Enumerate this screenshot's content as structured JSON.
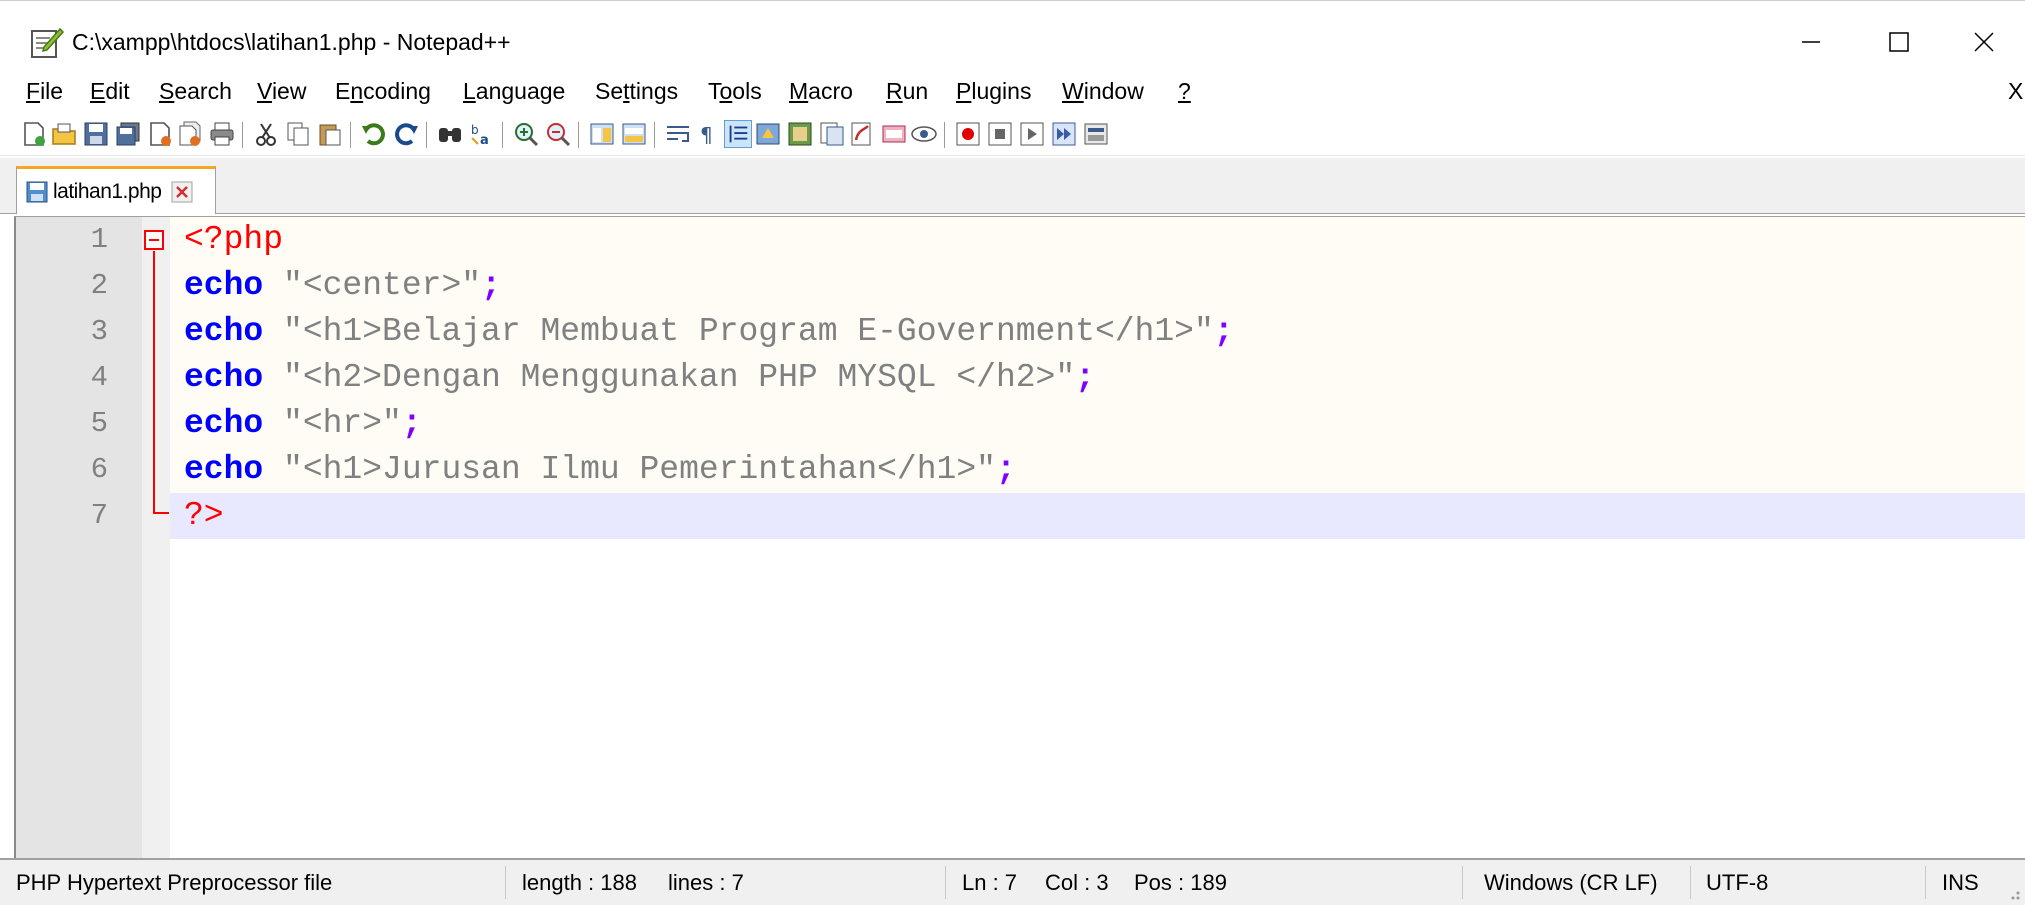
{
  "window": {
    "title": "C:\\xampp\\htdocs\\latihan1.php - Notepad++",
    "minimize_glyph": "—",
    "maximize_glyph": "☐",
    "close_glyph": "✕"
  },
  "menu": {
    "items": [
      {
        "mnemonic": "F",
        "rest": "ile"
      },
      {
        "mnemonic": "E",
        "rest": "dit"
      },
      {
        "mnemonic": "S",
        "rest": "earch"
      },
      {
        "mnemonic": "V",
        "rest": "iew"
      },
      {
        "pre": "E",
        "mnemonic": "n",
        "rest": "coding"
      },
      {
        "mnemonic": "L",
        "rest": "anguage"
      },
      {
        "pre": "Se",
        "mnemonic": "t",
        "rest": "tings"
      },
      {
        "pre": "T",
        "mnemonic": "o",
        "rest": "ols"
      },
      {
        "mnemonic": "M",
        "rest": "acro"
      },
      {
        "mnemonic": "R",
        "rest": "un"
      },
      {
        "mnemonic": "P",
        "rest": "lugins"
      },
      {
        "mnemonic": "W",
        "rest": "indow"
      },
      {
        "mnemonic": "?",
        "rest": ""
      }
    ],
    "close_document": "X"
  },
  "toolbar": {
    "icons": [
      "new-file-icon",
      "open-file-icon",
      "save-icon",
      "save-all-icon",
      "close-icon",
      "close-all-icon",
      "print-icon",
      "cut-icon",
      "copy-icon",
      "paste-icon",
      "undo-icon",
      "redo-icon",
      "find-icon",
      "replace-icon",
      "zoom-in-icon",
      "zoom-out-icon",
      "sync-vertical-icon",
      "sync-horizontal-icon",
      "word-wrap-icon",
      "show-all-chars-icon",
      "indent-guide-icon",
      "udl-icon",
      "doc-map-icon",
      "function-list-icon",
      "folder-workspace-icon",
      "doc-list-icon",
      "monitoring-icon",
      "record-macro-icon",
      "stop-record-icon",
      "play-macro-icon",
      "run-macro-multiple-icon",
      "save-macro-icon"
    ]
  },
  "tab": {
    "label": "latihan1.php"
  },
  "editor": {
    "line_numbers": [
      "1",
      "2",
      "3",
      "4",
      "5",
      "6",
      "7"
    ],
    "lines": [
      {
        "open_tag": "<?php"
      },
      {
        "kw": "echo",
        "str": " \"<center>\"",
        "semi": ";"
      },
      {
        "kw": "echo",
        "str": " \"<h1>Belajar Membuat Program E-Government</h1>\"",
        "semi": ";"
      },
      {
        "kw": "echo",
        "str": " \"<h2>Dengan Menggunakan PHP MYSQL </h2>\"",
        "semi": ";"
      },
      {
        "kw": "echo",
        "str": " \"<hr>\"",
        "semi": ";"
      },
      {
        "kw": "echo",
        "str": " \"<h1>Jurusan Ilmu Pemerintahan</h1>\"",
        "semi": ";"
      },
      {
        "close_tag": "?>"
      }
    ],
    "current_line": 7,
    "colors": {
      "keyword": "#0000ff",
      "string": "#808080",
      "operator": "#8000ff",
      "php_tag": "#ff0000",
      "current_line_bg": "#e8e8ff"
    }
  },
  "status": {
    "file_type": "PHP Hypertext Preprocessor file",
    "length": "length : 188",
    "lines": "lines : 7",
    "ln": "Ln : 7",
    "col": "Col : 3",
    "pos": "Pos : 189",
    "eol": "Windows (CR LF)",
    "encoding": "UTF-8",
    "mode": "INS"
  }
}
